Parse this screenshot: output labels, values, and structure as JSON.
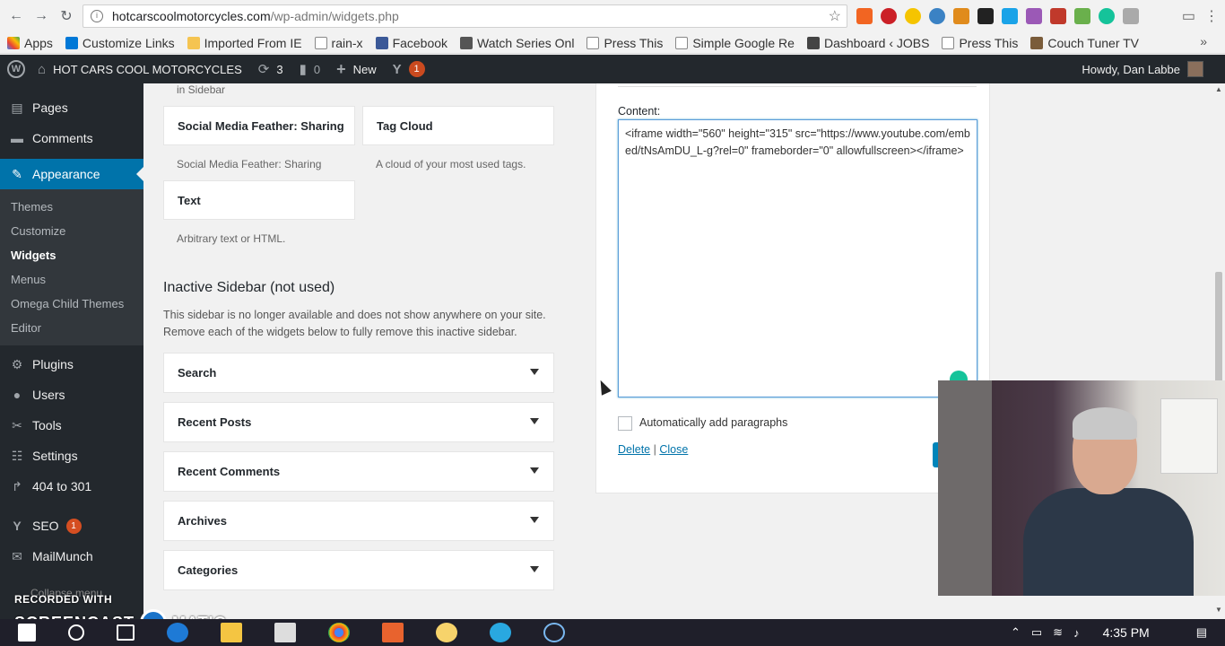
{
  "browser": {
    "url_host": "hotcarscoolmotorcycles.com",
    "url_path": "/wp-admin/widgets.php",
    "bookmarks": [
      "Apps",
      "Customize Links",
      "Imported From IE",
      "rain-x",
      "Facebook",
      "Watch Series Onl",
      "Press This",
      "Simple Google Re",
      "Dashboard ‹ JOBS",
      "Press This",
      "Couch Tuner TV"
    ],
    "bookmarks_more": "»"
  },
  "adminbar": {
    "site_name": "HOT CARS COOL MOTORCYCLES",
    "updates_count": "3",
    "comments_count": "0",
    "new_label": "New",
    "yoast_count": "1",
    "howdy": "Howdy, Dan Labbe"
  },
  "sidebar": {
    "items_top": [
      {
        "icon": "pages-icon",
        "label": "Pages"
      },
      {
        "icon": "comments-icon",
        "label": "Comments"
      }
    ],
    "appearance": "Appearance",
    "submenu": [
      "Themes",
      "Customize",
      "Widgets",
      "Menus",
      "Omega Child Themes",
      "Editor"
    ],
    "items_bottom": [
      {
        "icon": "plugins-icon",
        "label": "Plugins"
      },
      {
        "icon": "users-icon",
        "label": "Users"
      },
      {
        "icon": "tools-icon",
        "label": "Tools"
      },
      {
        "icon": "settings-icon",
        "label": "Settings"
      },
      {
        "icon": "redirect-icon",
        "label": "404 to 301"
      }
    ],
    "seo": "SEO",
    "seo_badge": "1",
    "mailmunch": "MailMunch",
    "collapse": "Collapse menu"
  },
  "widgets": {
    "top_desc": "in Sidebar",
    "tiles": [
      {
        "title": "Social Media Feather: Sharing",
        "desc": "Social Media Feather: Sharing"
      },
      {
        "title": "Tag Cloud",
        "desc": "A cloud of your most used tags."
      },
      {
        "title": "Text",
        "desc": "Arbitrary text or HTML."
      }
    ]
  },
  "inactive": {
    "title": "Inactive Sidebar (not used)",
    "description": "This sidebar is no longer available and does not show anywhere on your site. Remove each of the widgets below to fully remove this inactive sidebar.",
    "widgets": [
      "Search",
      "Recent Posts",
      "Recent Comments",
      "Archives",
      "Categories"
    ]
  },
  "editor": {
    "content_label": "Content:",
    "content_value": "<iframe width=\"560\" height=\"315\" src=\"https://www.youtube.com/embed/tNsAmDU_L-g?rel=0\" frameborder=\"0\" allowfullscreen></iframe>",
    "auto_paragraphs": "Automatically add paragraphs",
    "delete": "Delete",
    "separator": "|",
    "close": "Close"
  },
  "overlay": {
    "recorded_with": "RECORDED WITH",
    "screencast": "SCREENCAST",
    "matic": "MATIC"
  },
  "taskbar": {
    "clock": "4:35 PM"
  }
}
